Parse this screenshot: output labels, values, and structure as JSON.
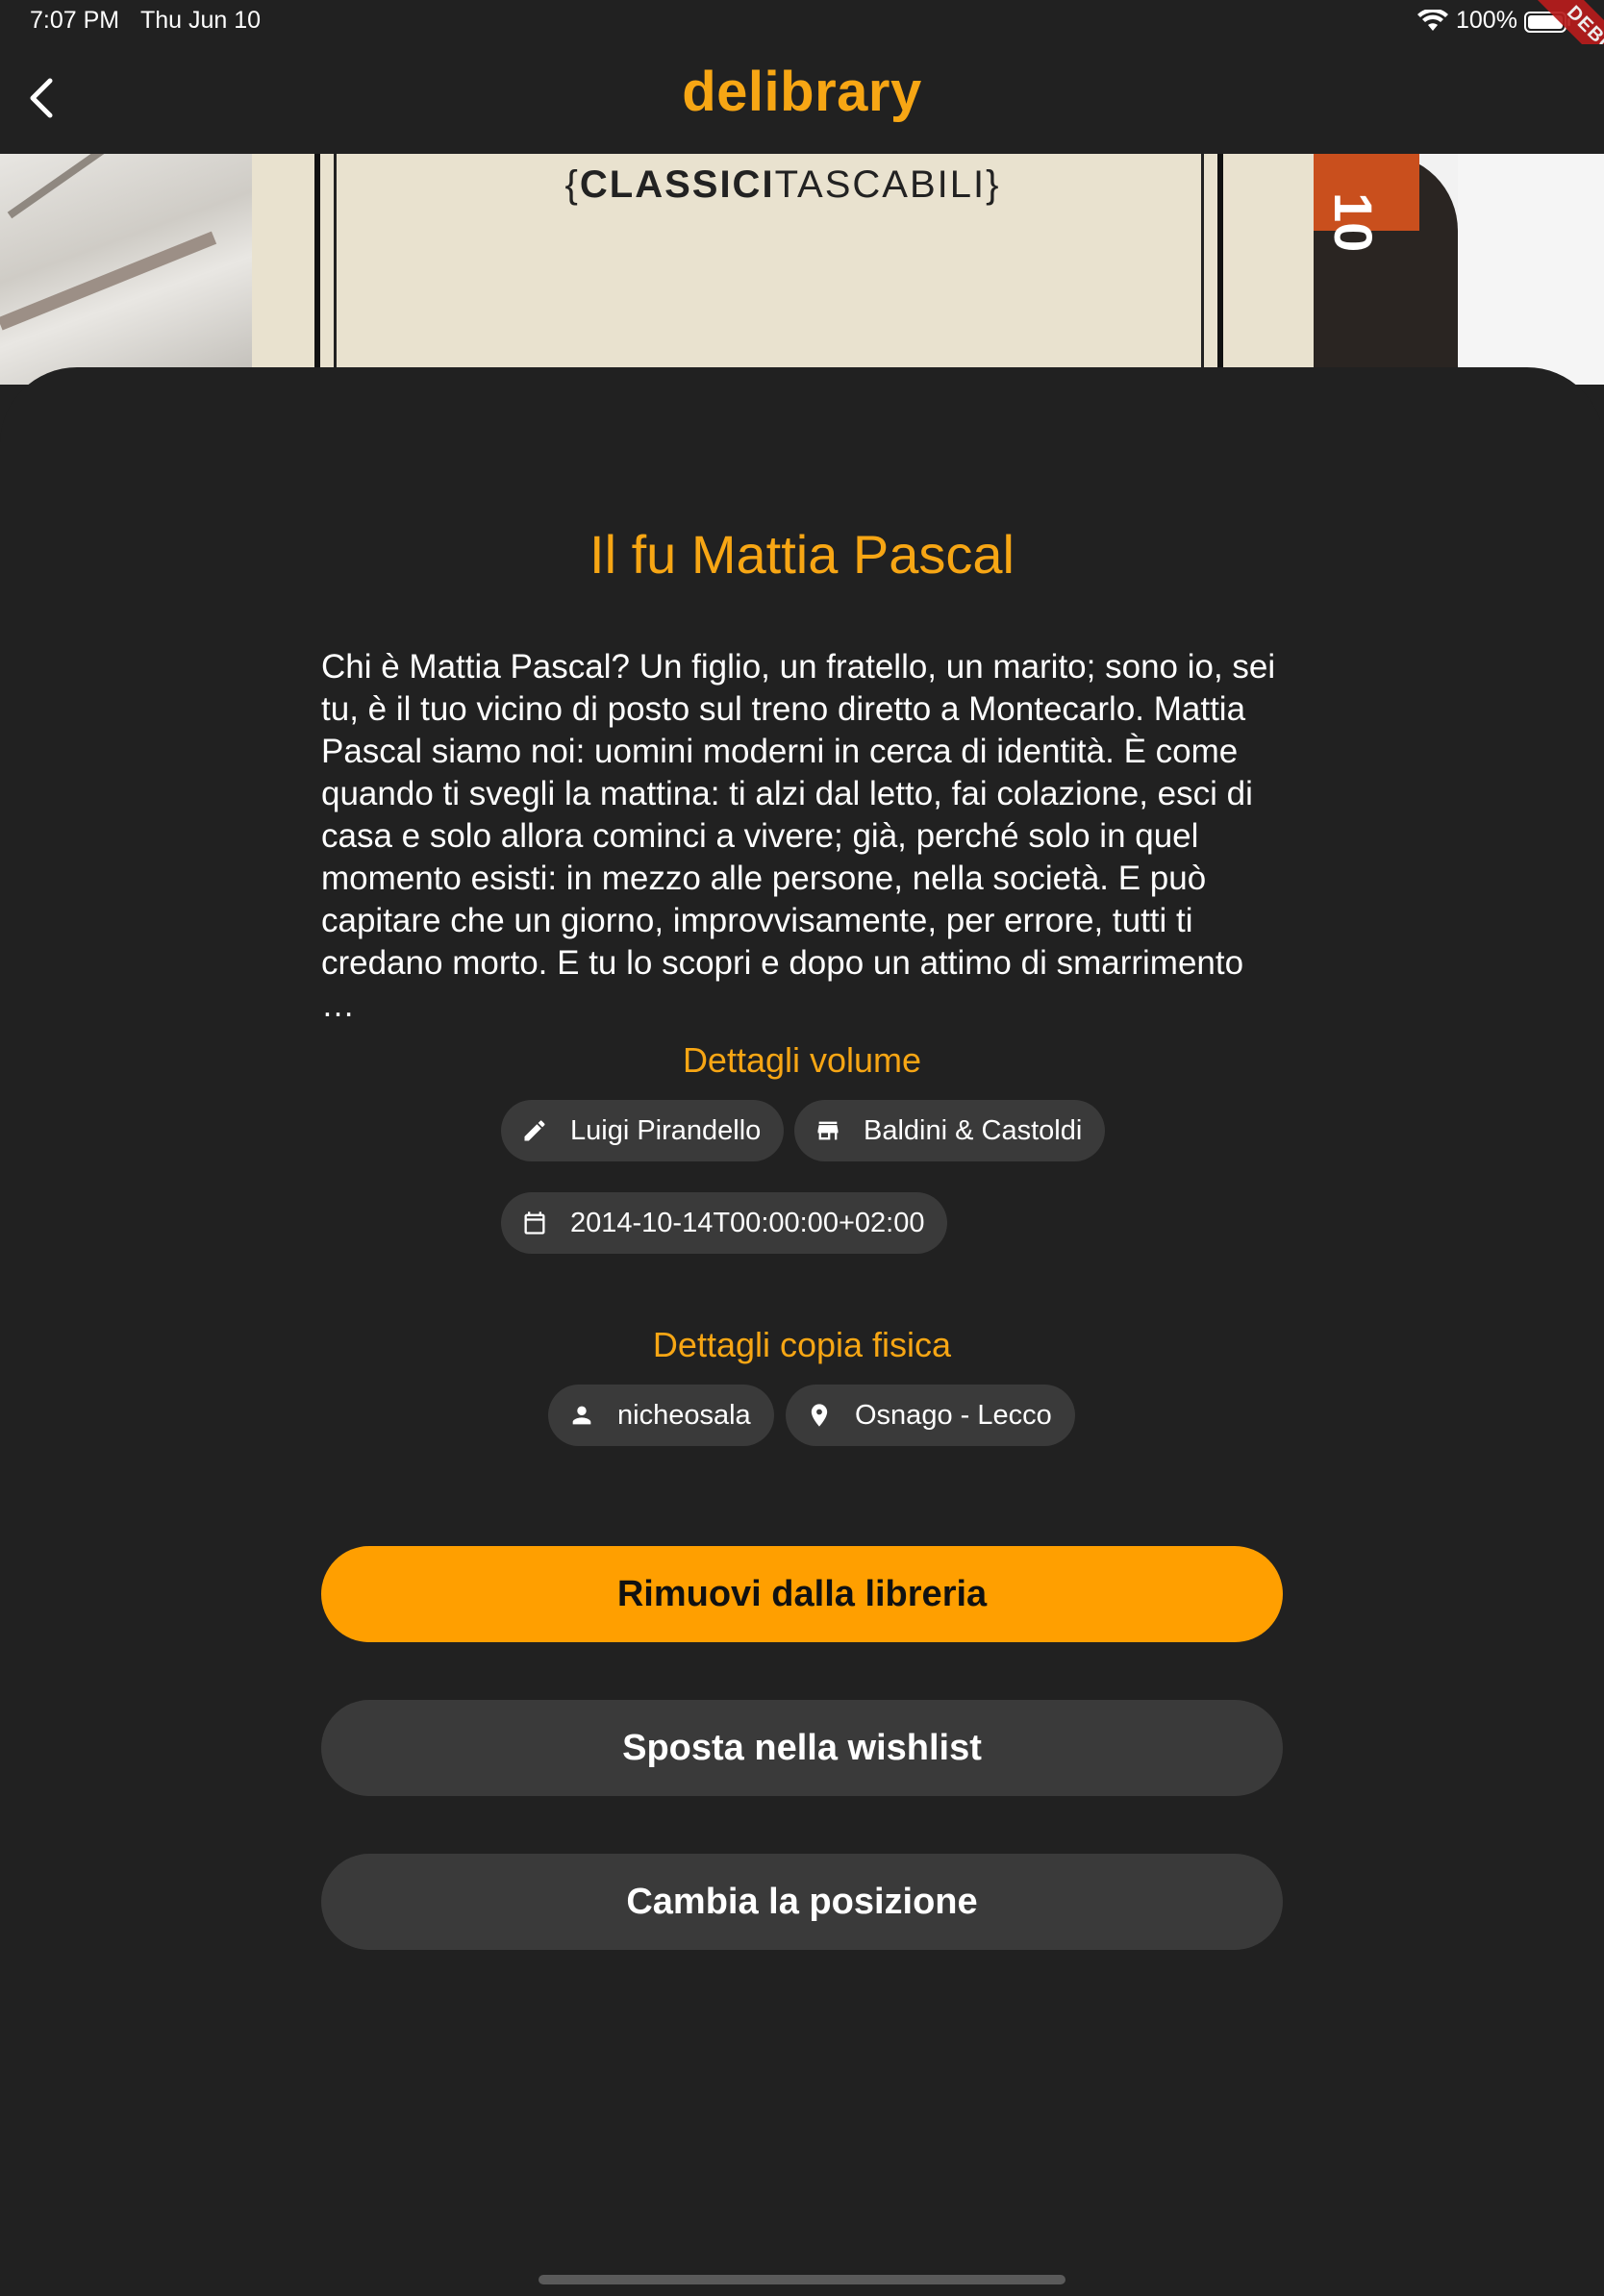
{
  "status_bar": {
    "time": "7:07 PM",
    "date": "Thu Jun 10",
    "battery": "100%",
    "debug_label": "DEBUG"
  },
  "app_bar": {
    "title": "delibrary",
    "back_icon": "chevron-left-icon"
  },
  "cover": {
    "series_bold": "CLASSICI",
    "series_rest": "TASCABILI",
    "brace_open": "{",
    "brace_close": "}",
    "side_number": "10"
  },
  "book": {
    "title": "Il fu Mattia Pascal",
    "description": "Chi è Mattia Pascal? Un figlio, un fratello, un marito; sono io, sei tu, è il tuo vicino di posto sul treno diretto a Montecarlo. Mattia Pascal siamo noi: uomini moderni in cerca di identità. È come quando ti svegli la mattina: ti alzi dal letto, fai colazione, esci di casa e solo allora cominci a vivere; già, perché solo in quel momento esisti: in mezzo alle persone, nella società. E può capitare che un giorno, improvvisamente, per errore, tutti ti credano morto. E tu lo scopri e dopo un attimo di smarrimento …"
  },
  "volume_details": {
    "title": "Dettagli volume",
    "author": {
      "label": "Luigi Pirandello",
      "icon": "pencil-icon"
    },
    "publisher": {
      "label": "Baldini & Castoldi",
      "icon": "store-icon"
    },
    "date": {
      "label": "2014-10-14T00:00:00+02:00",
      "icon": "calendar-icon"
    }
  },
  "copy_details": {
    "title": "Dettagli copia fisica",
    "owner": {
      "label": "nicheosala",
      "icon": "person-icon"
    },
    "location": {
      "label": "Osnago - Lecco",
      "icon": "location-pin-icon"
    }
  },
  "actions": {
    "remove": "Rimuovi dalla libreria",
    "wishlist": "Sposta nella wishlist",
    "position": "Cambia la posizione"
  },
  "colors": {
    "accent": "#f7a614",
    "primary_button": "#ff9f00",
    "background": "#212121",
    "chip": "#3a3a3a"
  }
}
